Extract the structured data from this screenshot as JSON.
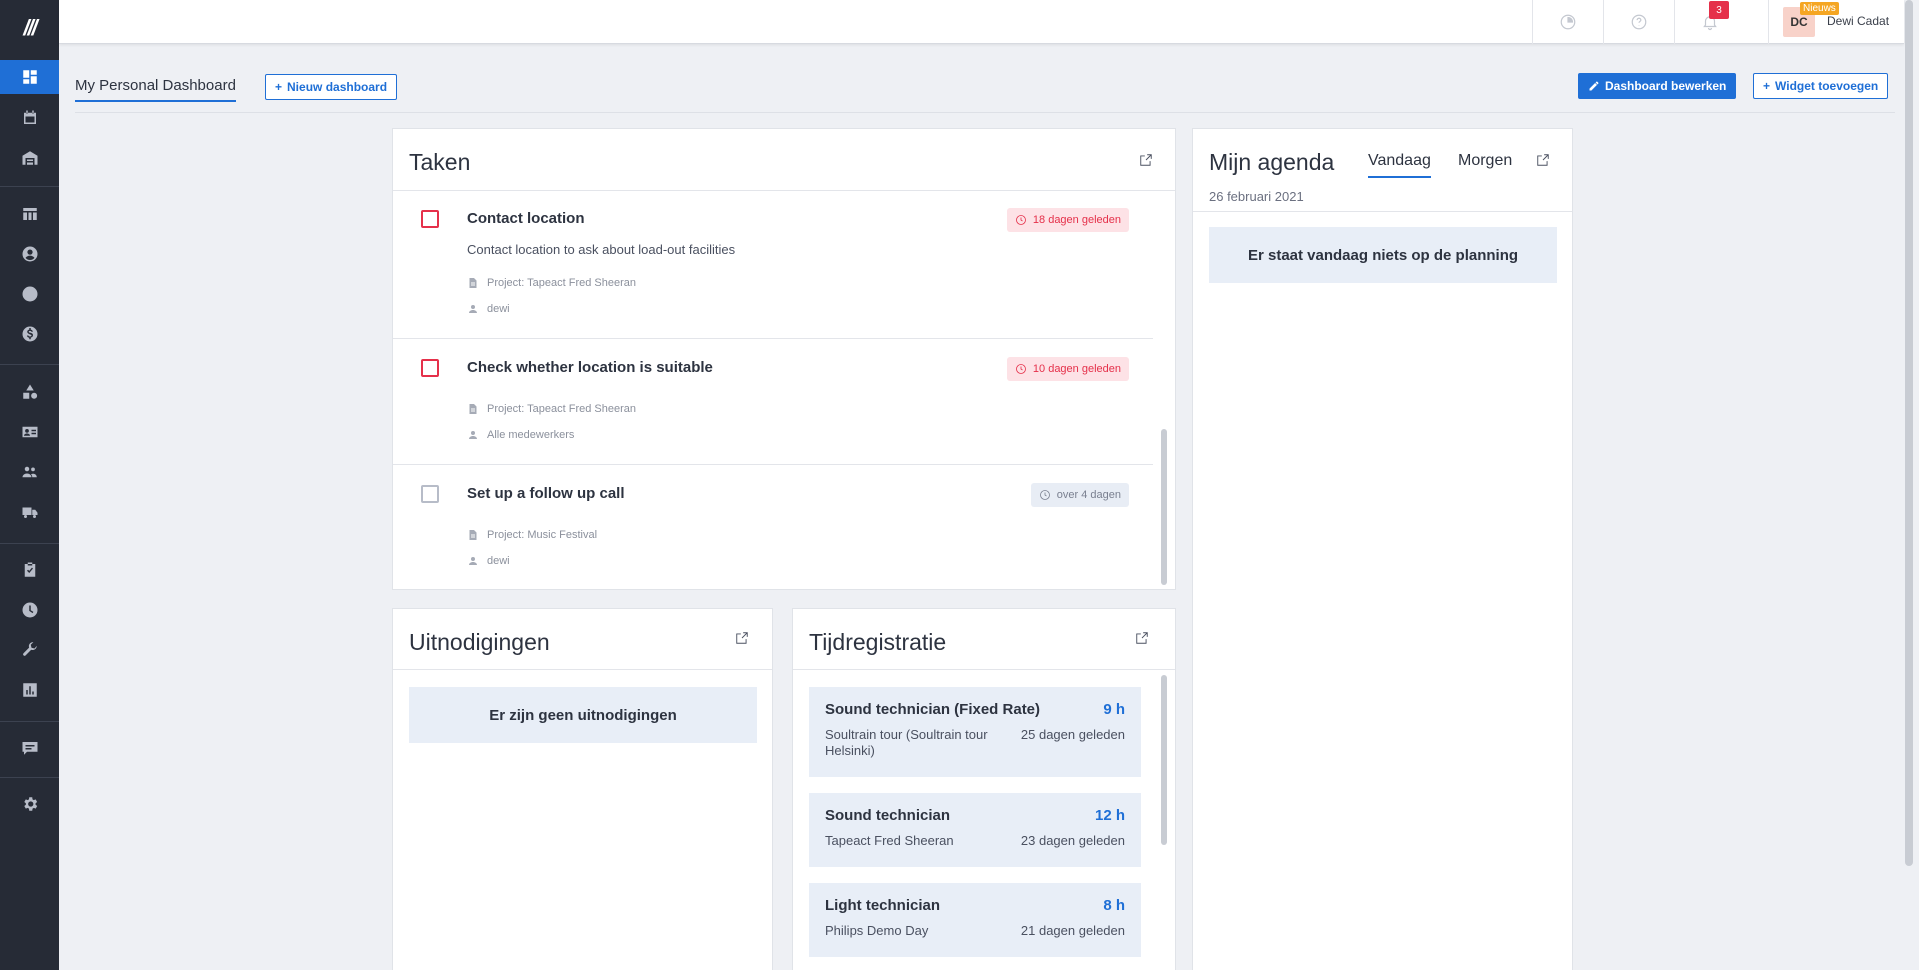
{
  "app": {
    "logo_text": "///"
  },
  "colors": {
    "accent": "#1f6fd6",
    "danger": "#e5304a",
    "sidebar": "#262b36"
  },
  "sidebar": {
    "items": [
      {
        "icon": "dashboard-icon",
        "active": true
      },
      {
        "icon": "calendar-icon"
      },
      {
        "icon": "warehouse-icon"
      },
      {
        "icon": "table-icon"
      },
      {
        "icon": "user-circle-icon"
      },
      {
        "icon": "sync-icon"
      },
      {
        "icon": "dollar-icon"
      },
      {
        "icon": "shapes-icon"
      },
      {
        "icon": "contact-card-icon"
      },
      {
        "icon": "group-icon"
      },
      {
        "icon": "truck-icon"
      },
      {
        "icon": "task-check-icon"
      },
      {
        "icon": "clock-icon"
      },
      {
        "icon": "wrench-icon"
      },
      {
        "icon": "chart-icon"
      },
      {
        "icon": "message-icon"
      },
      {
        "icon": "settings-icon"
      }
    ]
  },
  "topbar": {
    "notifications_count": "3",
    "user": {
      "initials": "DC",
      "news_label": "Nieuws",
      "name": "Dewi Cadat"
    }
  },
  "subheader": {
    "dashboard_tab": "My Personal Dashboard",
    "new_dashboard": "Nieuw dashboard",
    "edit_dashboard": "Dashboard bewerken",
    "add_widget": "Widget toevoegen"
  },
  "tasks": {
    "title": "Taken",
    "items": [
      {
        "title": "Contact location",
        "description": "Contact location to ask about load-out facilities",
        "project": "Project: Tapeact Fred Sheeran",
        "assignee": "dewi",
        "due": "18 dagen geleden",
        "status": "overdue"
      },
      {
        "title": "Check whether location is suitable",
        "project": "Project: Tapeact Fred Sheeran",
        "assignee": "Alle medewerkers",
        "due": "10 dagen geleden",
        "status": "overdue"
      },
      {
        "title": "Set up a follow up call",
        "project": "Project: Music Festival",
        "assignee": "dewi",
        "due": "over 4 dagen",
        "status": "future"
      }
    ]
  },
  "invitations": {
    "title": "Uitnodigingen",
    "empty": "Er zijn geen uitnodigingen"
  },
  "timereg": {
    "title": "Tijdregistratie",
    "items": [
      {
        "role": "Sound technician (Fixed Rate)",
        "hours": "9 h",
        "project": "Soultrain tour (Soultrain tour Helsinki)",
        "ago": "25 dagen geleden"
      },
      {
        "role": "Sound technician",
        "hours": "12 h",
        "project": "Tapeact Fred Sheeran",
        "ago": "23 dagen geleden"
      },
      {
        "role": "Light technician",
        "hours": "8 h",
        "project": "Philips Demo Day",
        "ago": "21 dagen geleden"
      }
    ]
  },
  "agenda": {
    "title": "Mijn agenda",
    "tab_today": "Vandaag",
    "tab_tomorrow": "Morgen",
    "date": "26 februari 2021",
    "empty": "Er staat vandaag niets op de planning"
  }
}
